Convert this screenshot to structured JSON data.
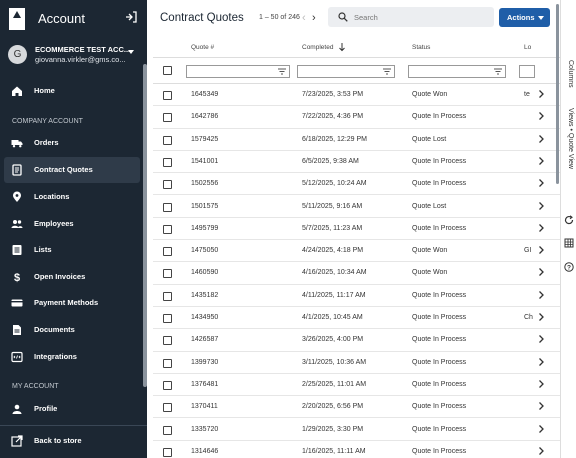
{
  "sidebar": {
    "title": "Account",
    "user": {
      "initial": "G",
      "name": "ECOMMERCE TEST ACC...",
      "email": "giovanna.virkler@gms.co..."
    },
    "home_label": "Home",
    "company_section": "COMPANY ACCOUNT",
    "company_items": [
      {
        "label": "Orders",
        "icon": "truck-icon"
      },
      {
        "label": "Contract Quotes",
        "icon": "quote-document-icon"
      },
      {
        "label": "Locations",
        "icon": "map-pin-icon"
      },
      {
        "label": "Employees",
        "icon": "people-icon"
      },
      {
        "label": "Lists",
        "icon": "list-icon"
      },
      {
        "label": "Open Invoices",
        "icon": "dollar-icon"
      },
      {
        "label": "Payment Methods",
        "icon": "credit-card-icon"
      },
      {
        "label": "Documents",
        "icon": "document-icon"
      },
      {
        "label": "Integrations",
        "icon": "integrations-icon"
      }
    ],
    "my_account_section": "MY ACCOUNT",
    "profile_label": "Profile",
    "back_label": "Back to store",
    "active_item": "Contract Quotes"
  },
  "header": {
    "title": "Contract Quotes",
    "pagination": "1 – 50 of 246",
    "prev": "‹",
    "next": "›",
    "search_placeholder": "Search",
    "actions_label": "Actions"
  },
  "columns": [
    "Quote #",
    "Completed",
    "Status",
    "Lo"
  ],
  "rows": [
    {
      "quote": "1645349",
      "completed": "7/23/2025, 3:53 PM",
      "status": "Quote Won",
      "loc": "te"
    },
    {
      "quote": "1642786",
      "completed": "7/22/2025, 4:36 PM",
      "status": "Quote In Process",
      "loc": ""
    },
    {
      "quote": "1579425",
      "completed": "6/18/2025, 12:29 PM",
      "status": "Quote Lost",
      "loc": ""
    },
    {
      "quote": "1541001",
      "completed": "6/5/2025, 9:38 AM",
      "status": "Quote In Process",
      "loc": ""
    },
    {
      "quote": "1502556",
      "completed": "5/12/2025, 10:24 AM",
      "status": "Quote In Process",
      "loc": ""
    },
    {
      "quote": "1501575",
      "completed": "5/11/2025, 9:16 AM",
      "status": "Quote Lost",
      "loc": ""
    },
    {
      "quote": "1495799",
      "completed": "5/7/2025, 11:23 AM",
      "status": "Quote In Process",
      "loc": ""
    },
    {
      "quote": "1475050",
      "completed": "4/24/2025, 4:18 PM",
      "status": "Quote Won",
      "loc": "GI"
    },
    {
      "quote": "1460590",
      "completed": "4/16/2025, 10:34 AM",
      "status": "Quote Won",
      "loc": ""
    },
    {
      "quote": "1435182",
      "completed": "4/11/2025, 11:17 AM",
      "status": "Quote In Process",
      "loc": ""
    },
    {
      "quote": "1434950",
      "completed": "4/1/2025, 10:45 AM",
      "status": "Quote In Process",
      "loc": "Ch"
    },
    {
      "quote": "1426587",
      "completed": "3/26/2025, 4:00 PM",
      "status": "Quote In Process",
      "loc": ""
    },
    {
      "quote": "1399730",
      "completed": "3/11/2025, 10:36 AM",
      "status": "Quote In Process",
      "loc": ""
    },
    {
      "quote": "1376481",
      "completed": "2/25/2025, 11:01 AM",
      "status": "Quote In Process",
      "loc": ""
    },
    {
      "quote": "1370411",
      "completed": "2/20/2025, 6:56 PM",
      "status": "Quote In Process",
      "loc": ""
    },
    {
      "quote": "1335720",
      "completed": "1/29/2025, 3:30 PM",
      "status": "Quote In Process",
      "loc": ""
    },
    {
      "quote": "1314646",
      "completed": "1/16/2025, 11:11 AM",
      "status": "Quote In Process",
      "loc": ""
    }
  ],
  "rail": {
    "columns_label": "Columns",
    "views_label": "Views • Quote View"
  },
  "colors": {
    "sidebar_bg": "#1c2733",
    "accent": "#1f5ea8"
  }
}
